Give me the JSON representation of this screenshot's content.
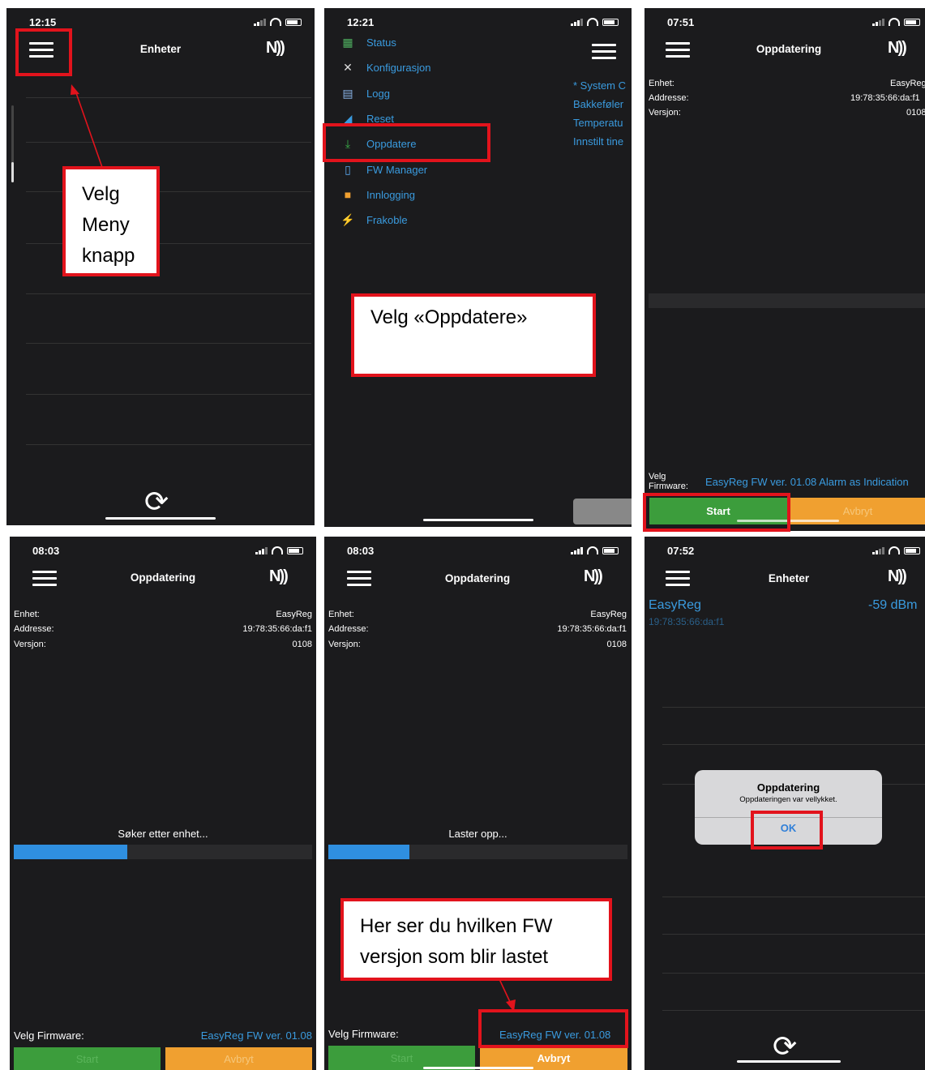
{
  "panels": {
    "p1": {
      "time": "12:15",
      "title": "Enheter",
      "nfc": "N))",
      "callout": [
        "Velg",
        "Meny",
        "knapp"
      ]
    },
    "p2": {
      "time": "12:21",
      "menu": [
        {
          "label": "Status",
          "icon": "status-icon"
        },
        {
          "label": "Konfigurasjon",
          "icon": "tools-icon"
        },
        {
          "label": "Logg",
          "icon": "log-icon"
        },
        {
          "label": "Reset",
          "icon": "reset-icon"
        },
        {
          "label": "Oppdatere",
          "icon": "download-icon"
        },
        {
          "label": "FW Manager",
          "icon": "file-icon"
        },
        {
          "label": "Innlogging",
          "icon": "lock-icon"
        },
        {
          "label": "Frakoble",
          "icon": "plug-icon"
        }
      ],
      "side": [
        "* System C",
        "Bakkeføler",
        "Temperatu",
        "Innstilt tine"
      ],
      "callout": "Velg «Oppdatere»"
    },
    "p3": {
      "time": "07:51",
      "title": "Oppdatering",
      "enhet_label": "Enhet:",
      "enhet_value": "EasyReg",
      "addr_label": "Addresse:",
      "addr_value": "19:78:35:66:da:f1",
      "ver_label": "Versjon:",
      "ver_value": "0108",
      "velg_label_1": "Velg",
      "velg_label_2": "Firmware:",
      "fw": "EasyReg FW ver. 01.08 Alarm as Indication",
      "start": "Start",
      "avbryt": "Avbryt"
    },
    "p4": {
      "time": "08:03",
      "title": "Oppdatering",
      "enhet_label": "Enhet:",
      "enhet_value": "EasyReg",
      "addr_label": "Addresse:",
      "addr_value": "19:78:35:66:da:f1",
      "ver_label": "Versjon:",
      "ver_value": "0108",
      "status": "Søker etter enhet...",
      "progress": 0.38,
      "velg": "Velg Firmware:",
      "fw": "EasyReg FW ver. 01.08",
      "start": "Start",
      "avbryt": "Avbryt"
    },
    "p5": {
      "time": "08:03",
      "title": "Oppdatering",
      "enhet_label": "Enhet:",
      "enhet_value": "EasyReg",
      "addr_label": "Addresse:",
      "addr_value": "19:78:35:66:da:f1",
      "ver_label": "Versjon:",
      "ver_value": "0108",
      "status": "Laster opp...",
      "progress": 0.27,
      "velg": "Velg Firmware:",
      "fw": "EasyReg FW ver. 01.08",
      "start": "Start",
      "avbryt": "Avbryt",
      "callout_1": "Her ser du hvilken FW",
      "callout_2": "versjon som blir lastet"
    },
    "p6": {
      "time": "07:52",
      "title": "Enheter",
      "device": "EasyReg",
      "rssi": "-59 dBm",
      "mac": "19:78:35:66:da:f1",
      "dialog_title": "Oppdatering",
      "dialog_msg": "Oppdateringen var vellykket.",
      "dialog_ok": "OK"
    }
  },
  "colors": {
    "panel_bg": "#1b1b1d",
    "accent_blue": "#3a9bdf",
    "annotation_red": "#e2131c",
    "start_green": "#3c9d3c",
    "avbryt_orange": "#f0a030"
  }
}
